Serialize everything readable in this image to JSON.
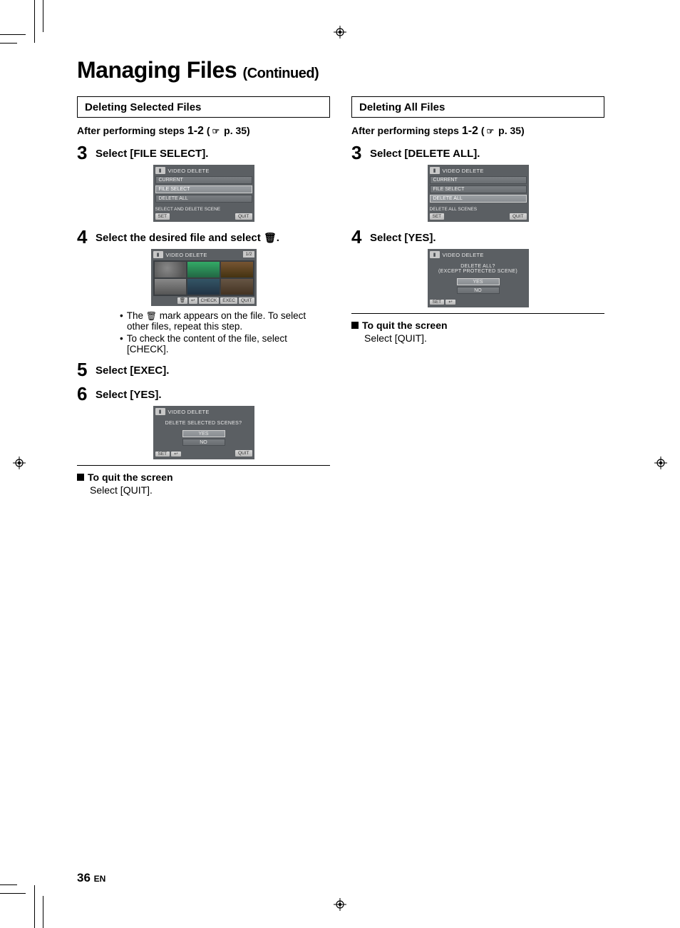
{
  "page": {
    "title_main": "Managing Files",
    "title_cont": "(Continued)",
    "number": "36",
    "lang": "EN"
  },
  "left": {
    "section": "Deleting Selected Files",
    "intro_a": "After performing steps ",
    "intro_steps": "1-2",
    "intro_b": " (",
    "intro_c": " p. 35)",
    "step3": "Select [FILE SELECT].",
    "step4": "Select the desired file and select ",
    "step4_tail": ".",
    "bullet1a": "The ",
    "bullet1b": " mark appears on the file. To select other files, repeat this step.",
    "bullet2": "To check the content of the file, select [CHECK].",
    "step5": "Select [EXEC].",
    "step6": "Select [YES].",
    "quit_h": "To quit the screen",
    "quit_b": "Select [QUIT].",
    "lcd1": {
      "title": "VIDEO DELETE",
      "r1": "CURRENT",
      "r2": "FILE SELECT",
      "r3": "DELETE ALL",
      "help": "SELECT AND DELETE SCENE",
      "set": "SET",
      "quit": "QUIT"
    },
    "lcd2": {
      "title": "VIDEO DELETE",
      "pager": "1/2",
      "b_check": "CHECK",
      "b_exec": "EXEC",
      "b_quit": "QUIT"
    },
    "lcd3": {
      "title": "VIDEO DELETE",
      "msg": "DELETE SELECTED SCENES?",
      "yes": "YES",
      "no": "NO",
      "set": "SET",
      "quit": "QUIT"
    }
  },
  "right": {
    "section": "Deleting All Files",
    "intro_a": "After performing steps ",
    "intro_steps": "1-2",
    "intro_b": " (",
    "intro_c": " p. 35)",
    "step3": "Select [DELETE ALL].",
    "step4": "Select [YES].",
    "quit_h": "To quit the screen",
    "quit_b": "Select [QUIT].",
    "lcd1": {
      "title": "VIDEO DELETE",
      "r1": "CURRENT",
      "r2": "FILE SELECT",
      "r3": "DELETE ALL",
      "help": "DELETE ALL SCENES",
      "set": "SET",
      "quit": "QUIT"
    },
    "lcd2": {
      "title": "VIDEO DELETE",
      "msg1": "DELETE ALL?",
      "msg2": "(EXCEPT PROTECTED SCENE)",
      "yes": "YES",
      "no": "NO",
      "set": "SET"
    }
  }
}
